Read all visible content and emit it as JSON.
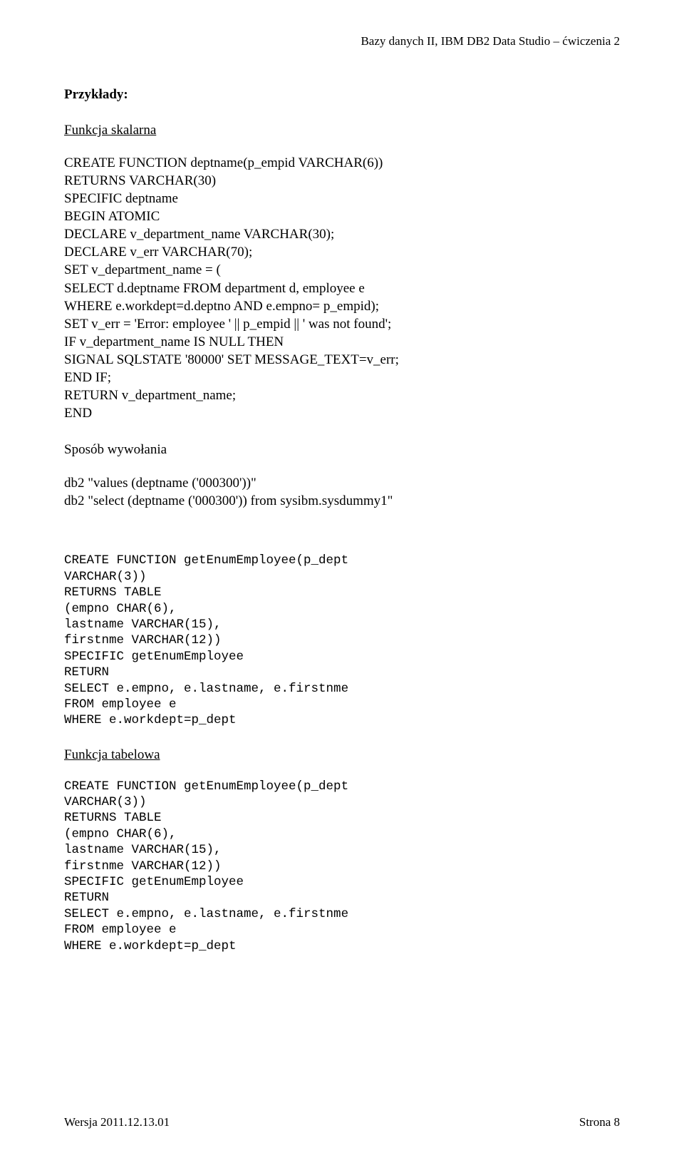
{
  "header": {
    "text": "Bazy danych II, IBM DB2 Data Studio – ćwiczenia 2"
  },
  "sections": {
    "examples_title": "Przykłady:",
    "scalar_function_label": "Funkcja skalarna",
    "scalar_function_code": "CREATE FUNCTION deptname(p_empid VARCHAR(6))\nRETURNS VARCHAR(30)\nSPECIFIC deptname\nBEGIN ATOMIC\nDECLARE v_department_name VARCHAR(30);\nDECLARE v_err VARCHAR(70);\nSET v_department_name = (\nSELECT d.deptname FROM department d, employee e\nWHERE e.workdept=d.deptno AND e.empno= p_empid);\nSET v_err = 'Error: employee ' || p_empid || ' was not found';\nIF v_department_name IS NULL THEN\nSIGNAL SQLSTATE '80000' SET MESSAGE_TEXT=v_err;\nEND IF;\nRETURN v_department_name;\nEND",
    "invocation_label": "Sposób wywołania",
    "invocation_code": "db2 \"values (deptname ('000300'))\"\ndb2 \"select (deptname ('000300')) from sysibm.sysdummy1\"",
    "mono_block_1": "CREATE FUNCTION getEnumEmployee(p_dept\nVARCHAR(3))\nRETURNS TABLE\n(empno CHAR(6),\nlastname VARCHAR(15),\nfirstnme VARCHAR(12))\nSPECIFIC getEnumEmployee\nRETURN\nSELECT e.empno, e.lastname, e.firstnme\nFROM employee e\nWHERE e.workdept=p_dept",
    "table_function_label": "Funkcja tabelowa",
    "mono_block_2": "CREATE FUNCTION getEnumEmployee(p_dept\nVARCHAR(3))\nRETURNS TABLE\n(empno CHAR(6),\nlastname VARCHAR(15),\nfirstnme VARCHAR(12))\nSPECIFIC getEnumEmployee\nRETURN\nSELECT e.empno, e.lastname, e.firstnme\nFROM employee e\nWHERE e.workdept=p_dept"
  },
  "footer": {
    "version": "Wersja 2011.12.13.01",
    "page": "Strona  8"
  }
}
